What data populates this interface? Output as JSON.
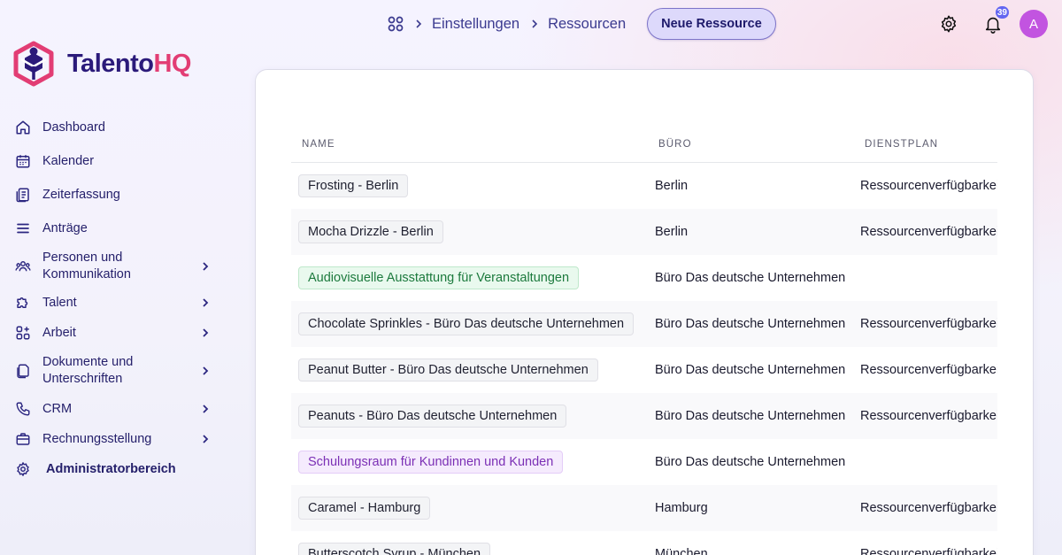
{
  "brand": {
    "name_part1": "Talento",
    "name_part2": "HQ",
    "colors": {
      "primary": "#2b1a7a",
      "accent": "#e23d74"
    }
  },
  "sidebar": {
    "items": [
      {
        "label": "Dashboard",
        "icon": "home-icon",
        "has_submenu": false
      },
      {
        "label": "Kalender",
        "icon": "calendar-icon",
        "has_submenu": false
      },
      {
        "label": "Zeiterfassung",
        "icon": "clipboard-icon",
        "has_submenu": false
      },
      {
        "label": "Anträge",
        "icon": "list-icon",
        "has_submenu": false
      },
      {
        "label": "Personen und Kommunikation",
        "icon": "people-icon",
        "has_submenu": true
      },
      {
        "label": "Talent",
        "icon": "puzzle-icon",
        "has_submenu": true
      },
      {
        "label": "Arbeit",
        "icon": "grid-plus-icon",
        "has_submenu": true
      },
      {
        "label": "Dokumente und Unterschriften",
        "icon": "documents-icon",
        "has_submenu": true
      },
      {
        "label": "CRM",
        "icon": "phone-icon",
        "has_submenu": true
      },
      {
        "label": "Rechnungsstellung",
        "icon": "briefcase-icon",
        "has_submenu": true
      },
      {
        "label": "Administratorbereich",
        "icon": "gear-icon",
        "has_submenu": false
      }
    ]
  },
  "header": {
    "breadcrumb": [
      "Einstellungen",
      "Ressourcen"
    ],
    "new_button": "Neue Ressource",
    "notifications_count": "39",
    "avatar_initial": "A"
  },
  "table": {
    "columns": [
      "NAME",
      "BÜRO",
      "DIENSTPLAN"
    ],
    "rows": [
      {
        "name": "Frosting - Berlin",
        "office": "Berlin",
        "plan": "Ressourcenverfügbarkeit",
        "tag": "gray"
      },
      {
        "name": "Mocha Drizzle - Berlin",
        "office": "Berlin",
        "plan": "Ressourcenverfügbarkeit",
        "tag": "gray"
      },
      {
        "name": "Audiovisuelle Ausstattung für Veranstaltungen",
        "office": "Büro Das deutsche Unternehmen",
        "plan": "",
        "tag": "green"
      },
      {
        "name": "Chocolate Sprinkles - Büro Das deutsche Unternehmen",
        "office": "Büro Das deutsche Unternehmen",
        "plan": "Ressourcenverfügbarkeit",
        "tag": "gray"
      },
      {
        "name": "Peanut Butter - Büro Das deutsche Unternehmen",
        "office": "Büro Das deutsche Unternehmen",
        "plan": "Ressourcenverfügbarkeit",
        "tag": "gray"
      },
      {
        "name": "Peanuts - Büro Das deutsche Unternehmen",
        "office": "Büro Das deutsche Unternehmen",
        "plan": "Ressourcenverfügbarkeit",
        "tag": "gray"
      },
      {
        "name": "Schulungsraum für Kundinnen und Kunden",
        "office": "Büro Das deutsche Unternehmen",
        "plan": "",
        "tag": "purple"
      },
      {
        "name": "Caramel - Hamburg",
        "office": "Hamburg",
        "plan": "Ressourcenverfügbarkeit",
        "tag": "gray"
      },
      {
        "name": "Butterscotch Syrup - München",
        "office": "München",
        "plan": "Ressourcenverfügbarkeit",
        "tag": "gray"
      }
    ]
  }
}
